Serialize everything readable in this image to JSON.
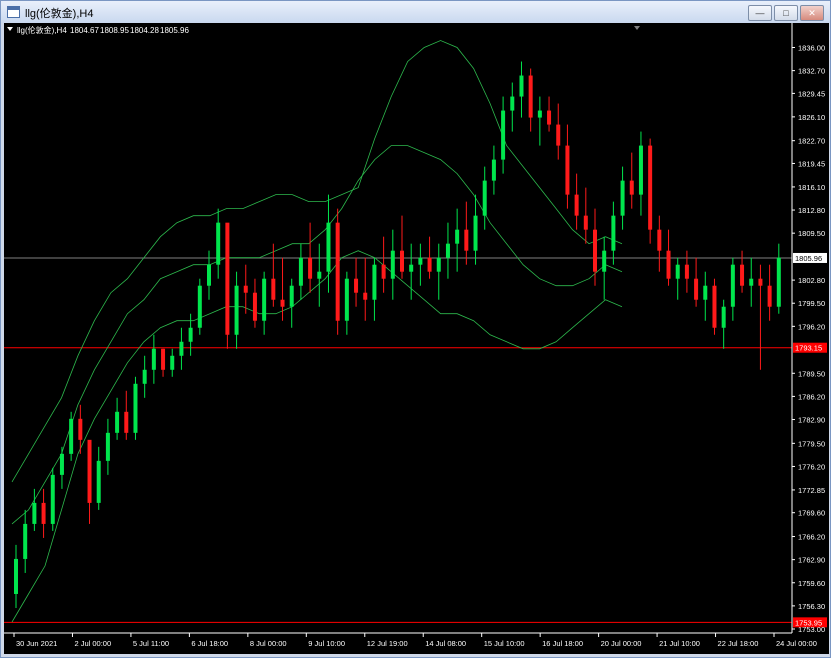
{
  "window": {
    "title": "llg(伦敦金),H4"
  },
  "window_buttons": {
    "minimize": "—",
    "maximize": "□",
    "close": "✕"
  },
  "info_line": {
    "symbol": "llg(伦敦金),H4",
    "open": "1804.67",
    "high": "1808.95",
    "low": "1804.28",
    "close": "1805.96"
  },
  "icons": [
    "app-icon",
    "triangle-down-icon",
    "minimize-icon",
    "maximize-icon",
    "close-icon"
  ],
  "colors": {
    "background": "#000000",
    "bull": "#00e64d",
    "bear": "#ff1a1a",
    "bands": "#2db94d",
    "price_line": "#808080",
    "level_line": "#ff0000",
    "axis_text": "#ffffff"
  },
  "chart_data": {
    "type": "candlestick",
    "y_axis": {
      "min": 1753.0,
      "max": 1837.5,
      "ticks": [
        "1836.00",
        "1832.70",
        "1829.45",
        "1826.10",
        "1822.70",
        "1819.45",
        "1816.10",
        "1812.80",
        "1809.50",
        "1802.80",
        "1799.50",
        "1796.20",
        "1789.50",
        "1786.20",
        "1782.90",
        "1779.50",
        "1776.20",
        "1772.85",
        "1769.60",
        "1766.20",
        "1762.90",
        "1759.60",
        "1756.30",
        "1753.00"
      ]
    },
    "x_axis": {
      "labels": [
        "30 Jun 2021",
        "2 Jul 00:00",
        "5 Jul 11:00",
        "6 Jul 18:00",
        "8 Jul 00:00",
        "9 Jul 10:00",
        "12 Jul 19:00",
        "14 Jul 08:00",
        "15 Jul 10:00",
        "16 Jul 18:00",
        "20 Jul 00:00",
        "21 Jul 10:00",
        "22 Jul 18:00",
        "24 Jul 00:00"
      ]
    },
    "current_price": {
      "value": 1805.96,
      "label": "1805.96"
    },
    "levels": [
      {
        "value": 1793.15,
        "label": "1793.15"
      },
      {
        "value": 1753.95,
        "label": "1753.95"
      }
    ],
    "candles": [
      [
        1758,
        1765,
        1756,
        1763
      ],
      [
        1763,
        1770,
        1761,
        1768
      ],
      [
        1768,
        1773,
        1767,
        1771
      ],
      [
        1771,
        1773,
        1766,
        1768
      ],
      [
        1768,
        1776,
        1767,
        1775
      ],
      [
        1775,
        1779,
        1773,
        1778
      ],
      [
        1778,
        1784,
        1777,
        1783
      ],
      [
        1783,
        1785,
        1778,
        1780
      ],
      [
        1780,
        1774,
        1768,
        1771
      ],
      [
        1771,
        1779,
        1770,
        1777
      ],
      [
        1777,
        1783,
        1775,
        1781
      ],
      [
        1781,
        1786,
        1780,
        1784
      ],
      [
        1784,
        1787,
        1780,
        1781
      ],
      [
        1781,
        1789,
        1780,
        1788
      ],
      [
        1788,
        1792,
        1786,
        1790
      ],
      [
        1790,
        1795,
        1788,
        1793
      ],
      [
        1793,
        1793,
        1789,
        1790
      ],
      [
        1790,
        1793,
        1789,
        1792
      ],
      [
        1792,
        1796,
        1790,
        1794
      ],
      [
        1794,
        1798,
        1792,
        1796
      ],
      [
        1796,
        1803,
        1795,
        1802
      ],
      [
        1802,
        1807,
        1800,
        1805
      ],
      [
        1805,
        1813,
        1803,
        1811
      ],
      [
        1811,
        1809,
        1793,
        1795
      ],
      [
        1795,
        1804,
        1793,
        1802
      ],
      [
        1802,
        1805,
        1798,
        1801
      ],
      [
        1801,
        1803,
        1796,
        1797
      ],
      [
        1797,
        1804,
        1795,
        1803
      ],
      [
        1803,
        1808,
        1799,
        1800
      ],
      [
        1800,
        1806,
        1797,
        1799
      ],
      [
        1799,
        1803,
        1796,
        1802
      ],
      [
        1802,
        1808,
        1800,
        1806
      ],
      [
        1806,
        1811,
        1801,
        1803
      ],
      [
        1803,
        1808,
        1799,
        1804
      ],
      [
        1804,
        1815,
        1801,
        1811
      ],
      [
        1811,
        1813,
        1795,
        1797
      ],
      [
        1797,
        1804,
        1795,
        1803
      ],
      [
        1803,
        1806,
        1799,
        1801
      ],
      [
        1801,
        1806,
        1797,
        1800
      ],
      [
        1800,
        1806,
        1797,
        1805
      ],
      [
        1805,
        1809,
        1801,
        1803
      ],
      [
        1803,
        1810,
        1800,
        1807
      ],
      [
        1807,
        1812,
        1803,
        1804
      ],
      [
        1804,
        1808,
        1800,
        1805
      ],
      [
        1805,
        1808,
        1802,
        1806
      ],
      [
        1806,
        1809,
        1803,
        1804
      ],
      [
        1804,
        1808,
        1800,
        1806
      ],
      [
        1806,
        1811,
        1803,
        1808
      ],
      [
        1808,
        1813,
        1804,
        1810
      ],
      [
        1810,
        1814,
        1805,
        1807
      ],
      [
        1807,
        1815,
        1805,
        1812
      ],
      [
        1812,
        1819,
        1810,
        1817
      ],
      [
        1817,
        1822,
        1815,
        1820
      ],
      [
        1820,
        1829,
        1818,
        1827
      ],
      [
        1827,
        1831,
        1824,
        1829
      ],
      [
        1829,
        1834,
        1826,
        1832
      ],
      [
        1832,
        1833,
        1824,
        1826
      ],
      [
        1826,
        1829,
        1822,
        1827
      ],
      [
        1827,
        1829,
        1824,
        1825
      ],
      [
        1825,
        1828,
        1820,
        1822
      ],
      [
        1822,
        1825,
        1813,
        1815
      ],
      [
        1815,
        1818,
        1810,
        1812
      ],
      [
        1812,
        1816,
        1808,
        1810
      ],
      [
        1810,
        1813,
        1802,
        1804
      ],
      [
        1804,
        1809,
        1800,
        1807
      ],
      [
        1807,
        1814,
        1805,
        1812
      ],
      [
        1812,
        1819,
        1810,
        1817
      ],
      [
        1817,
        1821,
        1813,
        1815
      ],
      [
        1815,
        1824,
        1812,
        1822
      ],
      [
        1822,
        1823,
        1808,
        1810
      ],
      [
        1810,
        1812,
        1804,
        1807
      ],
      [
        1807,
        1810,
        1802,
        1803
      ],
      [
        1803,
        1806,
        1800,
        1805
      ],
      [
        1805,
        1807,
        1801,
        1803
      ],
      [
        1803,
        1806,
        1799,
        1800
      ],
      [
        1800,
        1804,
        1797,
        1802
      ],
      [
        1802,
        1803,
        1795,
        1796
      ],
      [
        1796,
        1800,
        1793,
        1799
      ],
      [
        1799,
        1806,
        1797,
        1805
      ],
      [
        1805,
        1807,
        1801,
        1802
      ],
      [
        1802,
        1806,
        1799,
        1803
      ],
      [
        1803,
        1805,
        1790,
        1802
      ],
      [
        1802,
        1805,
        1797,
        1799
      ],
      [
        1799,
        1808,
        1798,
        1806
      ]
    ],
    "bands": {
      "upper": [
        1774,
        1778,
        1782,
        1786,
        1792,
        1797,
        1801,
        1803,
        1806,
        1809,
        1811,
        1812,
        1812,
        1813,
        1813,
        1814,
        1815,
        1815,
        1814,
        1814,
        1815,
        1816,
        1823,
        1829,
        1834,
        1836,
        1837,
        1836,
        1833,
        1828,
        1822,
        1819,
        1816,
        1813,
        1810,
        1808,
        1809,
        1808
      ],
      "middle": [
        1768,
        1770,
        1774,
        1778,
        1785,
        1790,
        1794,
        1798,
        1800,
        1803,
        1804,
        1805,
        1805,
        1806,
        1806,
        1806,
        1807,
        1808,
        1808,
        1810,
        1813,
        1817,
        1820,
        1822,
        1822,
        1821,
        1820,
        1818,
        1815,
        1811,
        1808,
        1805,
        1803,
        1802,
        1802,
        1803,
        1805,
        1804
      ],
      "lower": [
        1754,
        1758,
        1762,
        1770,
        1778,
        1783,
        1787,
        1791,
        1794,
        1796,
        1797,
        1797,
        1798,
        1799,
        1799,
        1798,
        1798,
        1799,
        1801,
        1803,
        1806,
        1807,
        1806,
        1804,
        1802,
        1800,
        1798,
        1798,
        1797,
        1795,
        1794,
        1793,
        1793,
        1794,
        1796,
        1798,
        1800,
        1799
      ]
    }
  }
}
